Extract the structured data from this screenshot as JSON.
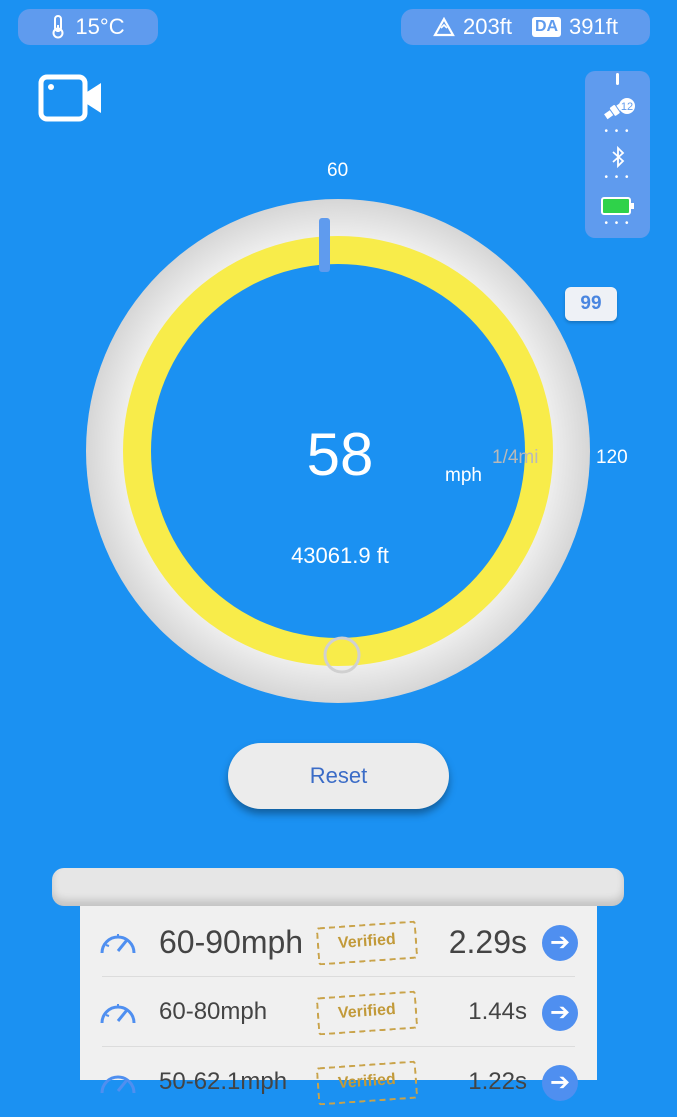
{
  "status": {
    "temperature": "15°C",
    "altitude": "203ft",
    "density_altitude_badge": "DA",
    "density_altitude": "391ft",
    "satellites": "12"
  },
  "icons": {
    "camera": "video-camera-icon",
    "thermometer": "thermometer-icon",
    "altitude": "mountain-icon",
    "satellite": "satellite-icon",
    "bluetooth": "bluetooth-icon",
    "battery": "battery-icon",
    "speedometer": "speedometer-icon",
    "arrow": "arrow-right-icon"
  },
  "gauge": {
    "tick_top": "60",
    "tick_right": "120",
    "speed": "58",
    "unit": "mph",
    "distance_label": "1/4mi",
    "distance": "43061.9 ft",
    "badge": "99",
    "progress_fraction": 0.99
  },
  "controls": {
    "reset_label": "Reset"
  },
  "results": [
    {
      "range": "60-90mph",
      "stamp": "Verified",
      "time": "2.29s"
    },
    {
      "range": "60-80mph",
      "stamp": "Verified",
      "time": "1.44s"
    },
    {
      "range": "50-62.1mph",
      "stamp": "Verified",
      "time": "1.22s"
    }
  ],
  "colors": {
    "background": "#1b91f2",
    "ring": "#f8ec4a",
    "accent": "#4f8ff0",
    "stamp": "#c29a3a"
  }
}
